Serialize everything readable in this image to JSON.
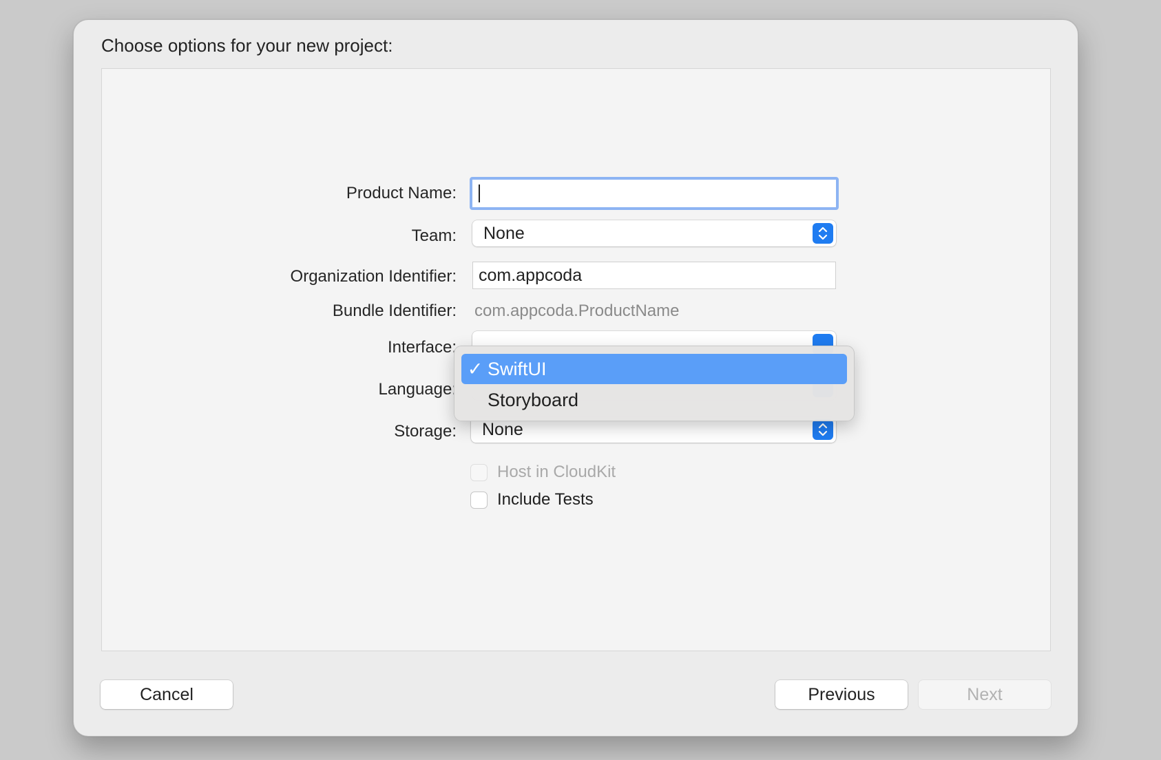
{
  "dialog": {
    "title": "Choose options for your new project:"
  },
  "form": {
    "product_name": {
      "label": "Product Name:",
      "value": ""
    },
    "team": {
      "label": "Team:",
      "value": "None"
    },
    "organization_identifier": {
      "label": "Organization Identifier:",
      "value": "com.appcoda"
    },
    "bundle_identifier": {
      "label": "Bundle Identifier:",
      "value": "com.appcoda.ProductName"
    },
    "interface": {
      "label": "Interface:",
      "value": "SwiftUI"
    },
    "language": {
      "label": "Language:"
    },
    "storage": {
      "label": "Storage:",
      "value": "None"
    },
    "host_in_cloudkit": {
      "label": "Host in CloudKit",
      "checked": false,
      "enabled": false
    },
    "include_tests": {
      "label": "Include Tests",
      "checked": false,
      "enabled": true
    }
  },
  "interface_menu": {
    "items": [
      {
        "label": "SwiftUI",
        "checkmark": "✓",
        "selected": true
      },
      {
        "label": "Storyboard",
        "checkmark": "",
        "selected": false
      }
    ]
  },
  "buttons": {
    "cancel": "Cancel",
    "previous": "Previous",
    "next": "Next"
  },
  "colors": {
    "accent": "#1f7cf1",
    "menu_highlight": "#5a9ef8",
    "focus_ring": "#8db4f3"
  },
  "icons": {
    "stepper": "chevron-up-down-icon",
    "checkmark": "checkmark-icon"
  }
}
